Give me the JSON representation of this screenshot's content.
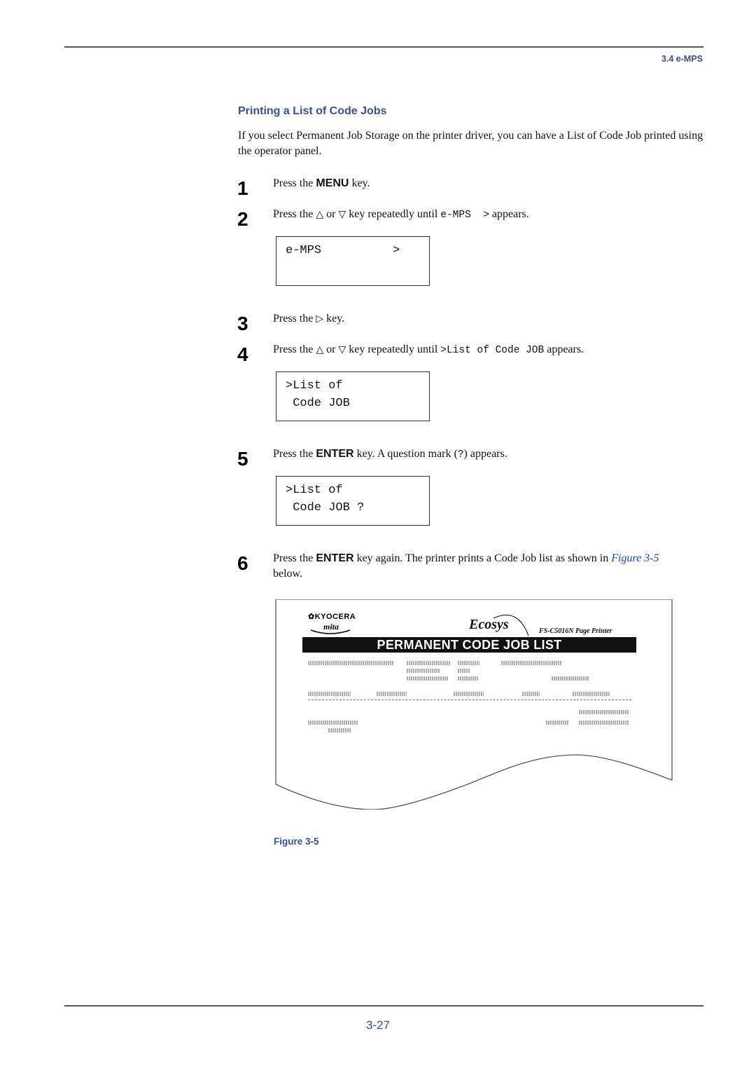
{
  "header": {
    "section": "3.4 e-MPS"
  },
  "section_title": "Printing a List of Code Jobs",
  "intro": "If you select Permanent Job Storage on the printer driver, you can have a List of Code Job printed using the operator panel.",
  "steps": [
    {
      "num": "1",
      "pre": "Press the ",
      "key": "MENU",
      "post": " key."
    },
    {
      "num": "2",
      "pre": "Press the ",
      "up_icon": "△",
      "mid": " or ",
      "down_icon": "▽",
      "mid2": " key repeatedly until ",
      "code": "e-MPS  >",
      "post": " appears."
    },
    {
      "num": "3",
      "pre": "Press the ",
      "right_icon": "▷",
      "post": " key."
    },
    {
      "num": "4",
      "pre": "Press the ",
      "up_icon": "△",
      "mid": " or ",
      "down_icon": "▽",
      "mid2": " key repeatedly until ",
      "code": ">List of Code JOB",
      "post": " appears."
    },
    {
      "num": "5",
      "pre": "Press the ",
      "key": "ENTER",
      "mid": " key. A question mark (",
      "code": "?",
      "post": ") appears."
    },
    {
      "num": "6",
      "pre": "Press the ",
      "key": "ENTER",
      "mid": " key again. The printer prints a Code Job list as shown in ",
      "link": "Figure 3-5",
      "post": " below."
    }
  ],
  "lcd": [
    {
      "line1": "e-MPS          >",
      "line2": ""
    },
    {
      "line1": ">List of",
      "line2": " Code JOB"
    },
    {
      "line1": ">List of",
      "line2": " Code JOB ?"
    }
  ],
  "figure": {
    "brand": "KYOCERA",
    "brand_sub": "mita",
    "ecosys": "Ecosys",
    "model": "FS-C5016N  Page Printer",
    "banner": "PERMANENT CODE JOB LIST",
    "caption": "Figure 3-5"
  },
  "footer": {
    "page_number": "3-27"
  }
}
